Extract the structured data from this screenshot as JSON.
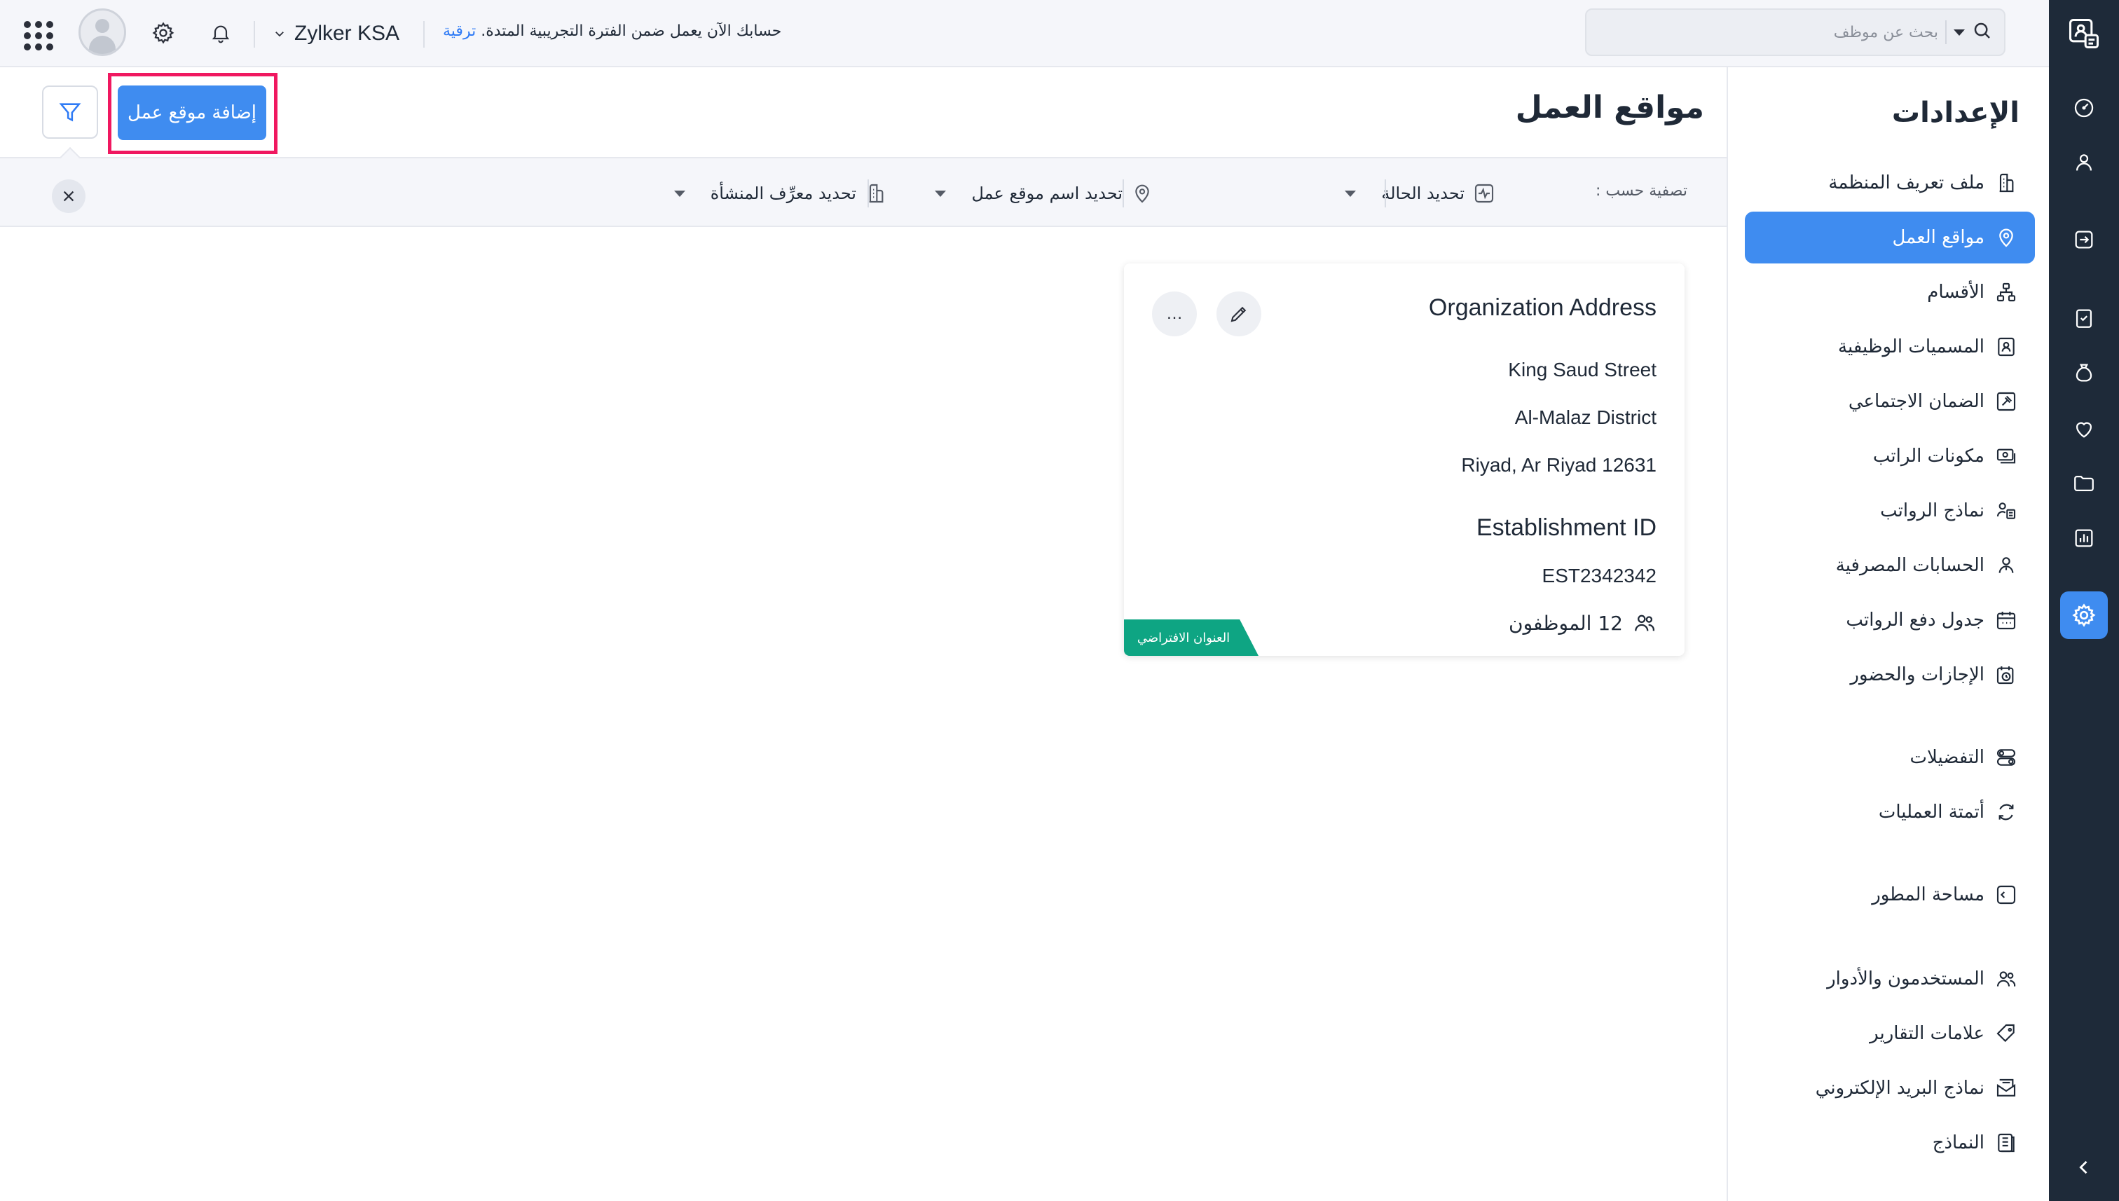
{
  "topbar": {
    "org_name": "Zylker KSA",
    "trial_text": "حسابك الآن يعمل ضمن الفترة التجريبية المتدة.",
    "upgrade_label": "ترقية",
    "search_placeholder": "بحث عن موظف"
  },
  "sidebar": {
    "title": "الإعدادات",
    "items": [
      {
        "label": "ملف تعريف المنظمة",
        "icon": "building-icon"
      },
      {
        "label": "مواقع العمل",
        "icon": "location-pin-icon",
        "active": true
      },
      {
        "label": "الأقسام",
        "icon": "hierarchy-icon"
      },
      {
        "label": "المسميات الوظيفية",
        "icon": "id-badge-icon"
      },
      {
        "label": "الضمان الاجتماعي",
        "icon": "gavel-icon"
      },
      {
        "label": "مكونات الراتب",
        "icon": "money-icon"
      },
      {
        "label": "نماذج الرواتب",
        "icon": "user-template-icon"
      },
      {
        "label": "الحسابات المصرفية",
        "icon": "user-bank-icon"
      },
      {
        "label": "جدول دفع الرواتب",
        "icon": "calendar-icon"
      },
      {
        "label": "الإجازات والحضور",
        "icon": "calendar-clock-icon"
      },
      {
        "label": "التفضيلات",
        "icon": "toggles-icon"
      },
      {
        "label": "أتمتة العمليات",
        "icon": "refresh-icon"
      },
      {
        "label": "مساحة المطور",
        "icon": "code-icon"
      },
      {
        "label": "المستخدمون والأدوار",
        "icon": "users-icon"
      },
      {
        "label": "علامات التقارير",
        "icon": "tag-icon"
      },
      {
        "label": "نماذج البريد الإلكتروني",
        "icon": "mail-template-icon"
      },
      {
        "label": "النماذج",
        "icon": "document-icon"
      }
    ]
  },
  "main": {
    "title": "مواقع العمل",
    "add_button_label": "إضافة موقع عمل",
    "filter_by_label": "تصفية حسب :",
    "filters": [
      {
        "label": "تحديد الحالة",
        "icon": "status-icon"
      },
      {
        "label": "تحديد اسم موقع عمل",
        "icon": "location-pin-icon"
      },
      {
        "label": "تحديد معرِّف المنشأة",
        "icon": "building-icon"
      }
    ]
  },
  "card": {
    "title": "Organization Address",
    "address_lines": [
      "King Saud Street",
      "Al-Malaz District",
      "Riyad, Ar Riyad 12631"
    ],
    "establishment_label": "Establishment ID",
    "establishment_id": "EST2342342",
    "employees_text": "12 الموظفون",
    "default_badge": "العنوان الافتراضي",
    "more_label": "…"
  },
  "colors": {
    "accent": "#3f8cf0",
    "rail": "#1e2a39",
    "highlight": "#f01860",
    "badge": "#0ea583"
  }
}
